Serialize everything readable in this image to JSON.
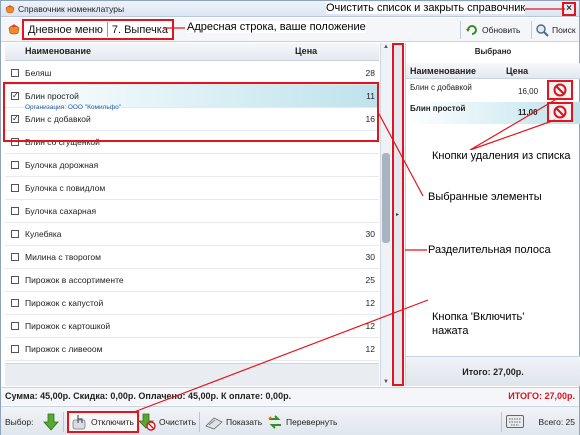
{
  "window": {
    "title": "Справочник номенклатуры"
  },
  "address": {
    "crumb1": "Дневное меню",
    "crumb2": "7. Выпечка",
    "refresh_label": "Обновить",
    "search_label": "Поиск"
  },
  "list": {
    "col_name": "Наименование",
    "col_price": "Цена",
    "rows": [
      {
        "name": "Беляш",
        "price": "28",
        "checked": false
      },
      {
        "name": "Блин простой",
        "price": "11",
        "checked": true,
        "org": "Организация: ООО \"Комильфо\""
      },
      {
        "name": "Блин с добавкой",
        "price": "16",
        "checked": true
      },
      {
        "name": "Блин со сгущенкой",
        "price": "",
        "checked": false
      },
      {
        "name": "Булочка дорожная",
        "price": "",
        "checked": false
      },
      {
        "name": "Булочка с повидлом",
        "price": "",
        "checked": false
      },
      {
        "name": "Булочка сахарная",
        "price": "",
        "checked": false
      },
      {
        "name": "Кулебяка",
        "price": "30",
        "checked": false
      },
      {
        "name": "Милина с творогом",
        "price": "30",
        "checked": false
      },
      {
        "name": "Пирожок в ассортименте",
        "price": "25",
        "checked": false
      },
      {
        "name": "Пирожок с капустой",
        "price": "12",
        "checked": false
      },
      {
        "name": "Пирожок с картошкой",
        "price": "12",
        "checked": false
      },
      {
        "name": "Пирожок с ливеоом",
        "price": "12",
        "checked": false
      }
    ]
  },
  "selected": {
    "title": "Выбрано",
    "col_name": "Наименование",
    "col_price": "Цена",
    "rows": [
      {
        "name": "Блин с добавкой",
        "price": "16,00"
      },
      {
        "name": "Блин простой",
        "price": "11,00"
      }
    ],
    "total": "Итого: 27,00р."
  },
  "summary": {
    "text": "Сумма: 45,00р.  Скидка: 0,00р.  Оплачено: 45,00р.  К оплате: 0,00р.",
    "itogo": "ИТОГО: 27,00р."
  },
  "toolbar": {
    "choice_label": "Выбор:",
    "disable_label": "Отключить",
    "clear_label": "Очистить",
    "show_label": "Показать",
    "flip_label": "Перевернуть",
    "total_count": "Всего: 25"
  },
  "annotations": {
    "close": "Очистить список и закрыть справочник",
    "address": "Адресная строка, ваше положение",
    "delete_buttons": "Кнопки удаления из списка",
    "selected_items": "Выбранные элементы",
    "splitter": "Разделительная полоса",
    "enable_button": "Кнопка 'Включить' нажата"
  },
  "colors": {
    "annotation_red": "#e2141c",
    "itogo_red": "#d7141c",
    "selection_cyan": "#bfe2ec"
  }
}
